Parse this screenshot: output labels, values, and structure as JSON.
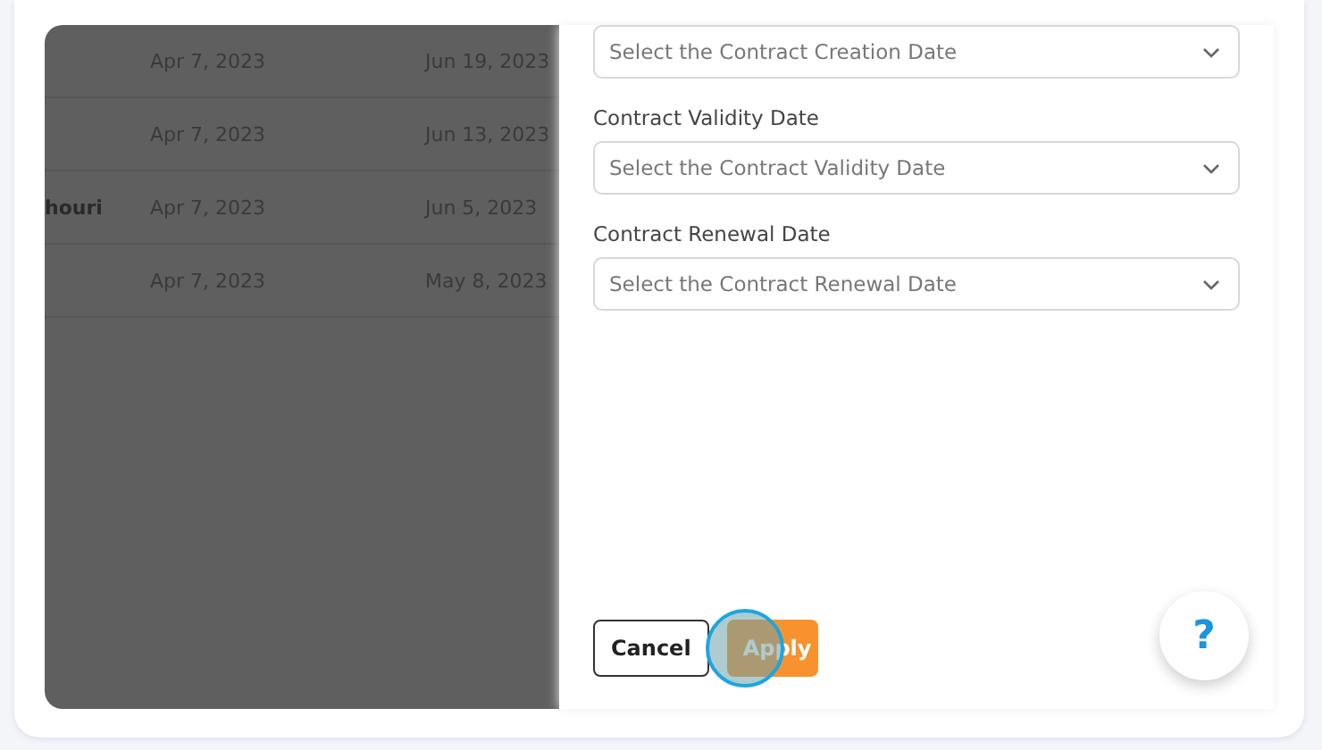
{
  "table": {
    "rows": [
      {
        "column_2": "Apr 7, 2023",
        "column_3": "Jun 19, 2023"
      },
      {
        "column_2": "Apr 7, 2023",
        "column_3": "Jun 13, 2023"
      },
      {
        "column_1": "houri",
        "column_2": "Apr 7, 2023",
        "column_3": "Jun 5, 2023"
      },
      {
        "column_2": "Apr 7, 2023",
        "column_3": "May 8, 2023"
      }
    ]
  },
  "filter_panel": {
    "fields": [
      {
        "placeholder": "Select the Contract Creation Date"
      },
      {
        "label": "Contract Validity Date",
        "placeholder": "Select the Contract Validity Date"
      },
      {
        "label": "Contract Renewal Date",
        "placeholder": "Select the Contract Renewal Date"
      }
    ],
    "buttons": [
      {
        "kind": "outline",
        "label": "Cancel",
        "tapped": false
      },
      {
        "kind": "primary",
        "label": "Apply",
        "tapped": true
      }
    ]
  },
  "help_button": {
    "label": "?"
  }
}
